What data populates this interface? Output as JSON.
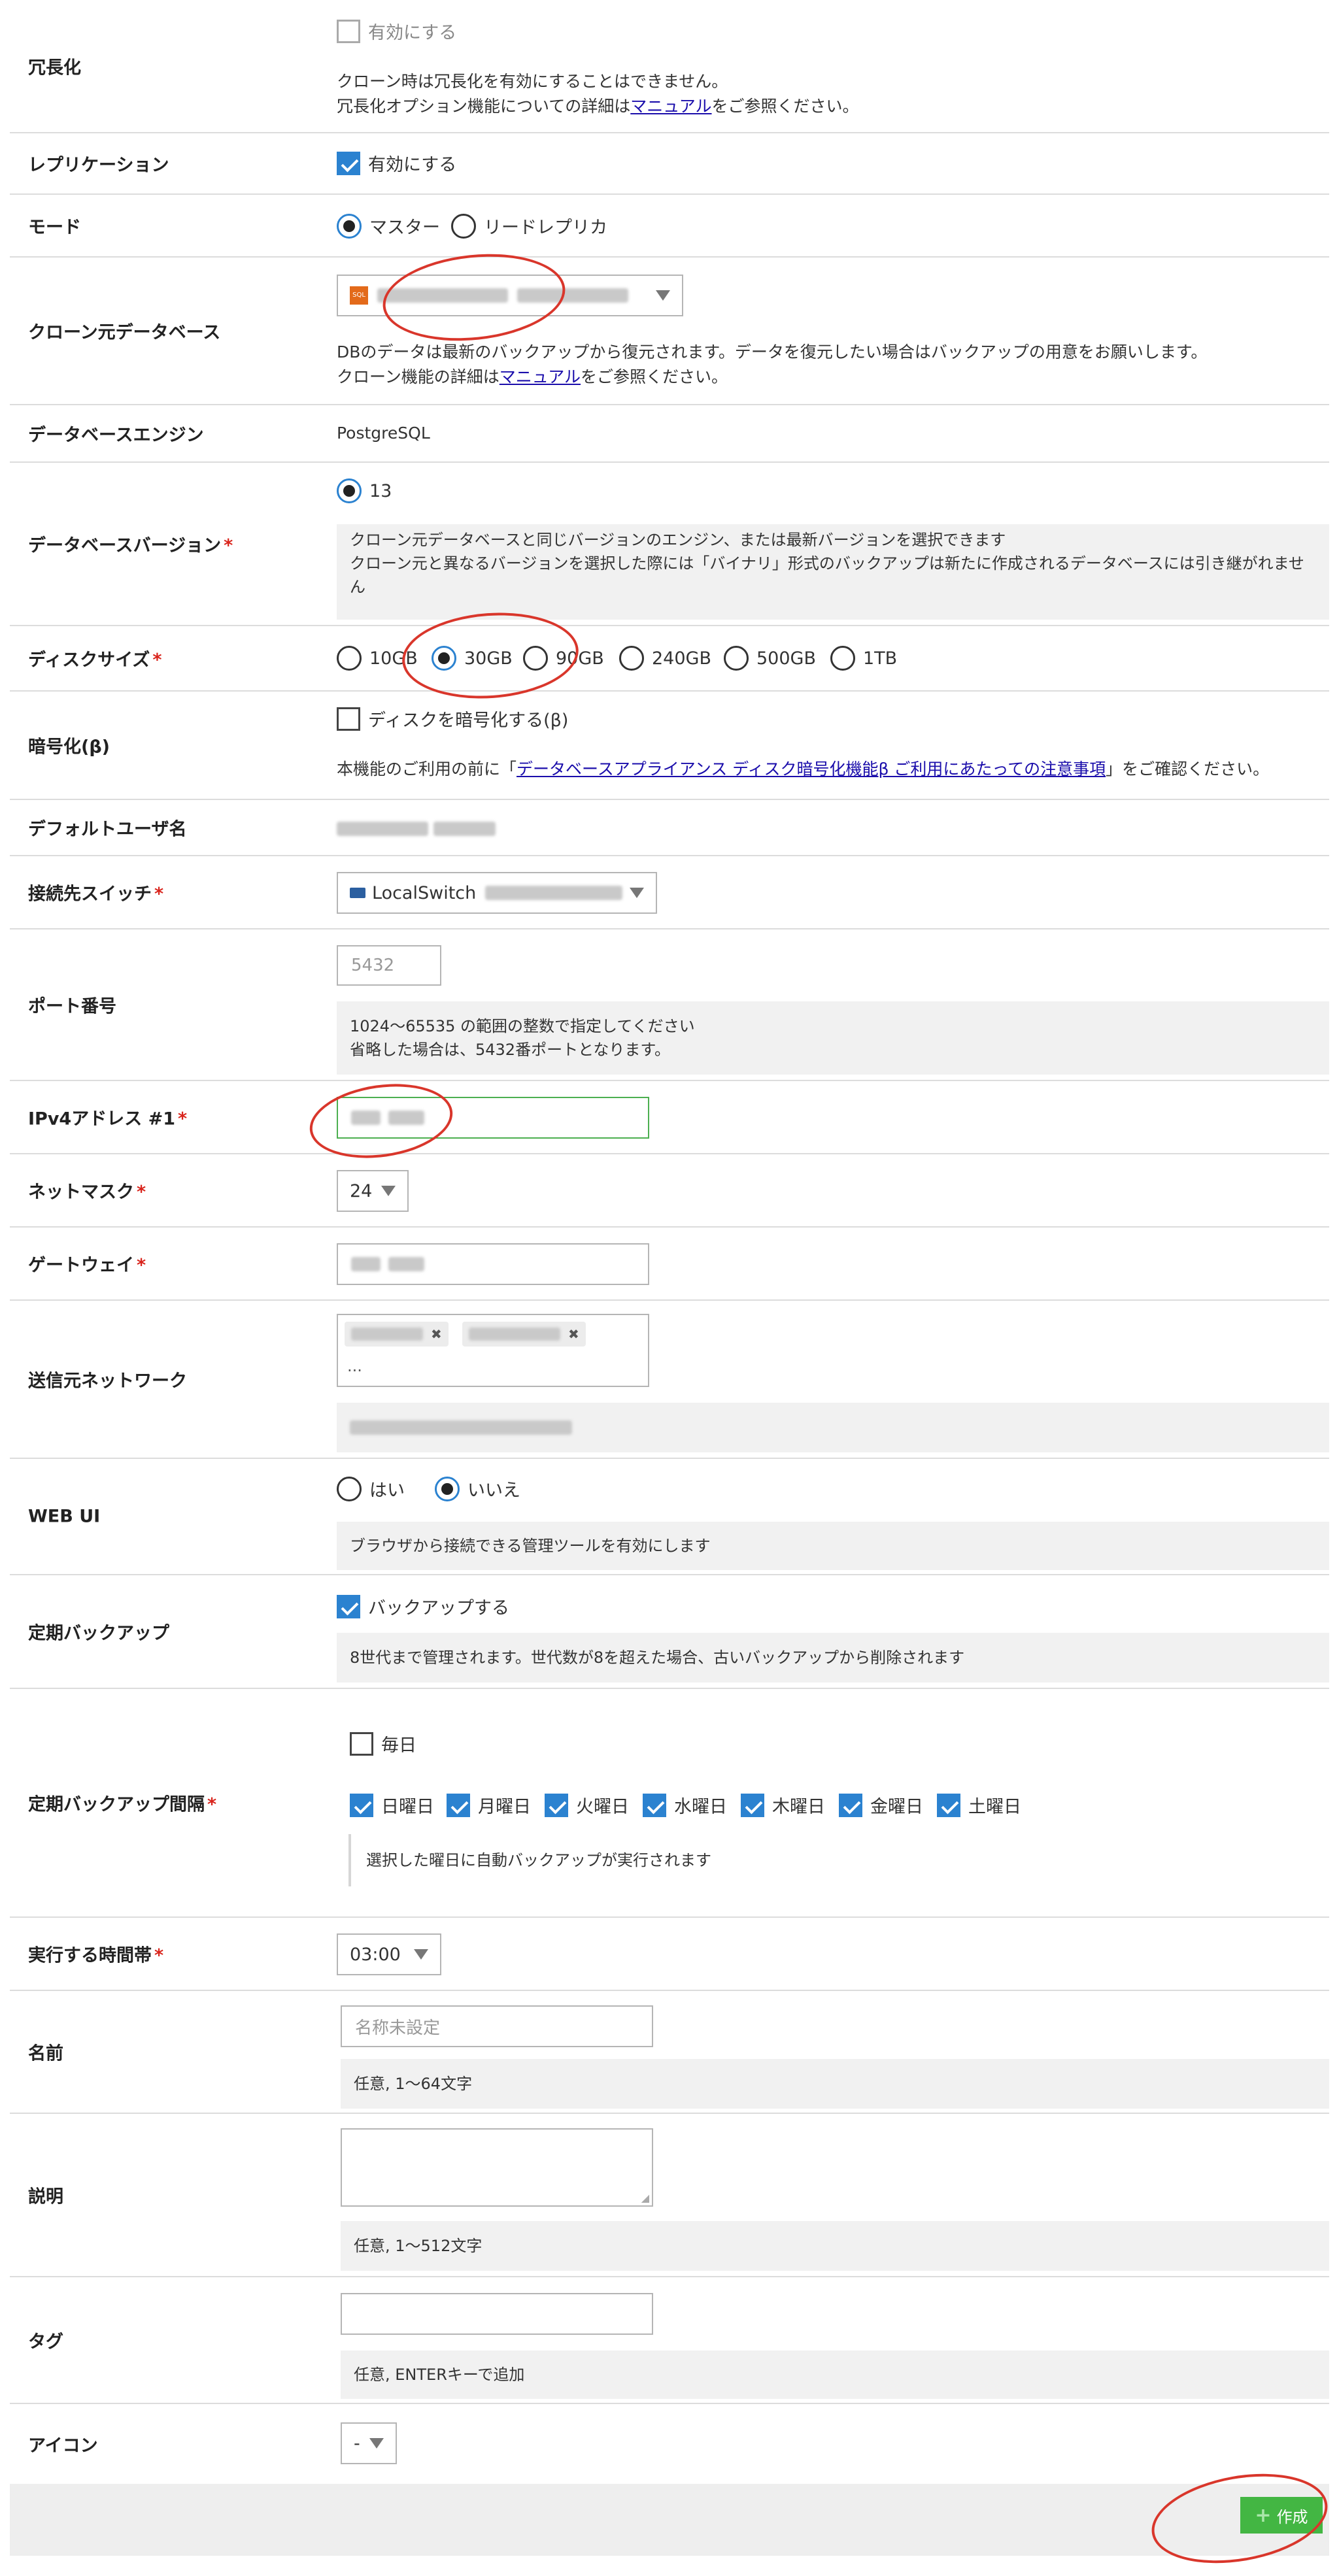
{
  "redundancy": {
    "label": "冗長化",
    "checkbox": "有効にする",
    "note1": "クローン時は冗長化を有効にすることはできません。",
    "note2_pre": "冗長化オプション機能についての詳細は",
    "note2_link": "マニュアル",
    "note2_post": "をご参照ください。"
  },
  "replication": {
    "label": "レプリケーション",
    "checkbox": "有効にする"
  },
  "mode": {
    "label": "モード",
    "options": [
      "マスター",
      "リードレプリカ"
    ]
  },
  "clone_source": {
    "label": "クローン元データベース",
    "select_icon": "SQL",
    "note1": "DBのデータは最新のバックアップから復元されます。データを復元したい場合はバックアップの用意をお願いします。",
    "note2_pre": "クローン機能の詳細は",
    "note2_link": "マニュアル",
    "note2_post": "をご参照ください。"
  },
  "engine": {
    "label": "データベースエンジン",
    "value": "PostgreSQL"
  },
  "db_version": {
    "label": "データベースバージョン",
    "option": "13",
    "help1": "クローン元データベースと同じバージョンのエンジン、または最新バージョンを選択できます",
    "help2": "クローン元と異なるバージョンを選択した際には「バイナリ」形式のバックアップは新たに作成されるデータベースには引き継がれませ",
    "help3": "ん"
  },
  "disk": {
    "label": "ディスクサイズ",
    "options": [
      "10GB",
      "30GB",
      "90GB",
      "240GB",
      "500GB",
      "1TB"
    ]
  },
  "encryption": {
    "label": "暗号化(β)",
    "checkbox": "ディスクを暗号化する(β)",
    "note_pre": "本機能のご利用の前に「",
    "note_link": "データベースアプライアンス ディスク暗号化機能β ご利用にあたっての注意事項",
    "note_post": "」をご確認ください。"
  },
  "default_user": {
    "label": "デフォルトユーザ名"
  },
  "switch": {
    "label": "接続先スイッチ",
    "value": "LocalSwitch"
  },
  "port": {
    "label": "ポート番号",
    "placeholder": "5432",
    "help1": "1024〜65535 の範囲の整数で指定してください",
    "help2": "省略した場合は、5432番ポートとなります。"
  },
  "ipv4": {
    "label": "IPv4アドレス #1"
  },
  "netmask": {
    "label": "ネットマスク",
    "value": "24"
  },
  "gateway": {
    "label": "ゲートウェイ"
  },
  "source_network": {
    "label": "送信元ネットワーク",
    "ellipsis": "..."
  },
  "webui": {
    "label": "WEB UI",
    "options": [
      "はい",
      "いいえ"
    ],
    "help": "ブラウザから接続できる管理ツールを有効にします"
  },
  "backup": {
    "label": "定期バックアップ",
    "checkbox": "バックアップする",
    "help": "8世代まで管理されます。世代数が8を超えた場合、古いバックアップから削除されます"
  },
  "backup_interval": {
    "label": "定期バックアップ間隔",
    "daily": "毎日",
    "days": [
      "日曜日",
      "月曜日",
      "火曜日",
      "水曜日",
      "木曜日",
      "金曜日",
      "土曜日"
    ],
    "help": "選択した曜日に自動バックアップが実行されます"
  },
  "time": {
    "label": "実行する時間帯",
    "value": "03:00"
  },
  "name": {
    "label": "名前",
    "placeholder": "名称未設定",
    "help": "任意, 1〜64文字"
  },
  "description": {
    "label": "説明",
    "help": "任意, 1〜512文字"
  },
  "tags": {
    "label": "タグ",
    "help": "任意, ENTERキーで追加"
  },
  "icon": {
    "label": "アイコン",
    "value": "-"
  },
  "footer": {
    "create": "作成"
  },
  "required_mark": "*",
  "colors": {
    "accent": "#2b82d0",
    "required": "#d9241c",
    "create": "#43b643",
    "annotation": "#d9362b"
  }
}
